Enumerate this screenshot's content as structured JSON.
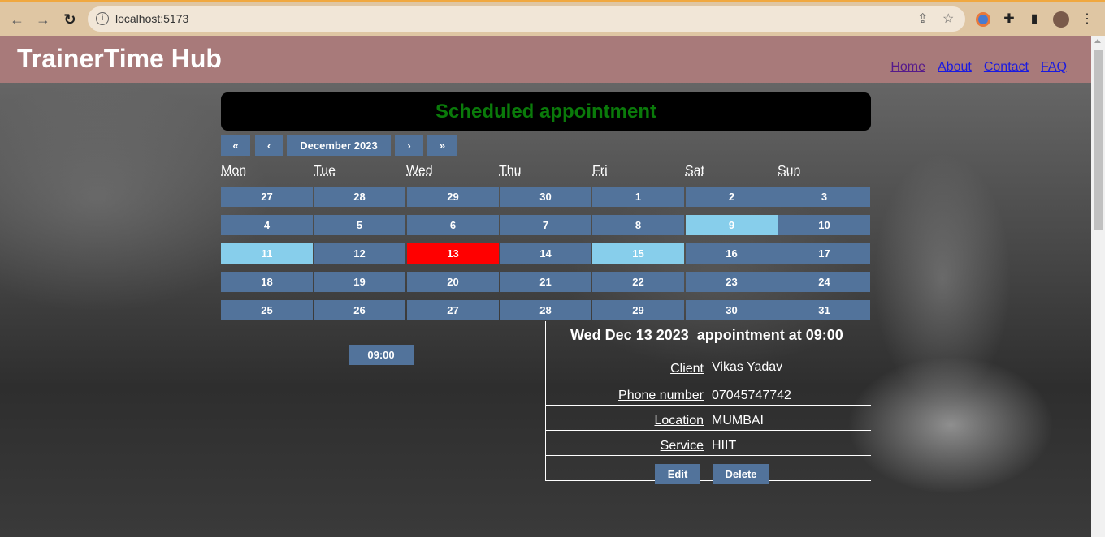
{
  "browser": {
    "url": "localhost:5173"
  },
  "site": {
    "brand": "TrainerTime Hub",
    "nav": [
      "Home",
      "About",
      "Contact",
      "FAQ"
    ]
  },
  "banner": "Scheduled appointment",
  "calendar": {
    "prev2": "«",
    "prev": "‹",
    "month": "December 2023",
    "next": "›",
    "next2": "»",
    "weekdays": [
      "Mon",
      "Tue",
      "Wed",
      "Thu",
      "Fri",
      "Sat",
      "Sun"
    ],
    "weeks": [
      [
        "27",
        "28",
        "29",
        "30",
        "1",
        "2",
        "3"
      ],
      [
        "4",
        "5",
        "6",
        "7",
        "8",
        "9",
        "10"
      ],
      [
        "11",
        "12",
        "13",
        "14",
        "15",
        "16",
        "17"
      ],
      [
        "18",
        "19",
        "20",
        "21",
        "22",
        "23",
        "24"
      ],
      [
        "25",
        "26",
        "27",
        "28",
        "29",
        "30",
        "31"
      ]
    ],
    "highlighted_days": [
      "9",
      "11",
      "15"
    ],
    "selected_day": "13",
    "colors": {
      "day": "#52739b",
      "highlight": "#87ceeb",
      "selected": "#ff0000"
    }
  },
  "time_slot": "09:00",
  "appointment": {
    "title": "Wed Dec 13 2023  appointment at 09:00",
    "fields": [
      {
        "label": "Client",
        "value": "Vikas Yadav"
      },
      {
        "label": "Phone number",
        "value": "07045747742"
      },
      {
        "label": "Location",
        "value": "MUMBAI"
      },
      {
        "label": "Service",
        "value": "HIIT"
      }
    ],
    "edit_label": "Edit",
    "delete_label": "Delete"
  }
}
